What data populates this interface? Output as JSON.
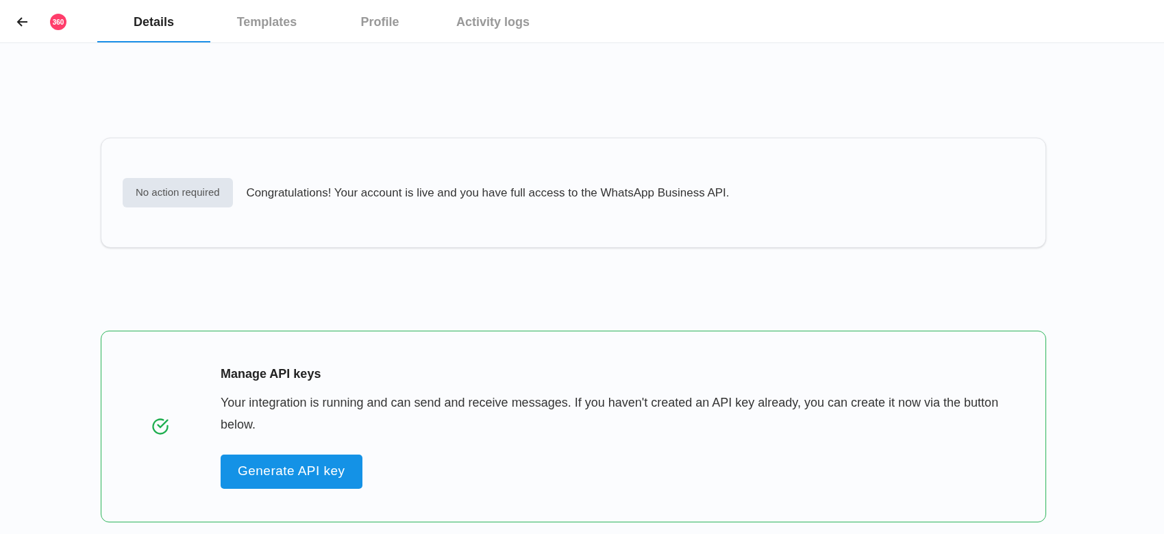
{
  "header": {
    "logo_text": "360",
    "tabs": [
      {
        "label": "Details",
        "selected": true
      },
      {
        "label": "Templates",
        "selected": false
      },
      {
        "label": "Profile",
        "selected": false
      },
      {
        "label": "Activity logs",
        "selected": false
      }
    ]
  },
  "status_card": {
    "badge": "No action required",
    "message": "Congratulations! Your account is live and you have full access to the WhatsApp Business API."
  },
  "api_card": {
    "title": "Manage API keys",
    "description": "Your integration is running and can send and receive messages. If you haven't created an API key already, you can create it now via the button below.",
    "button": "Generate API key"
  }
}
